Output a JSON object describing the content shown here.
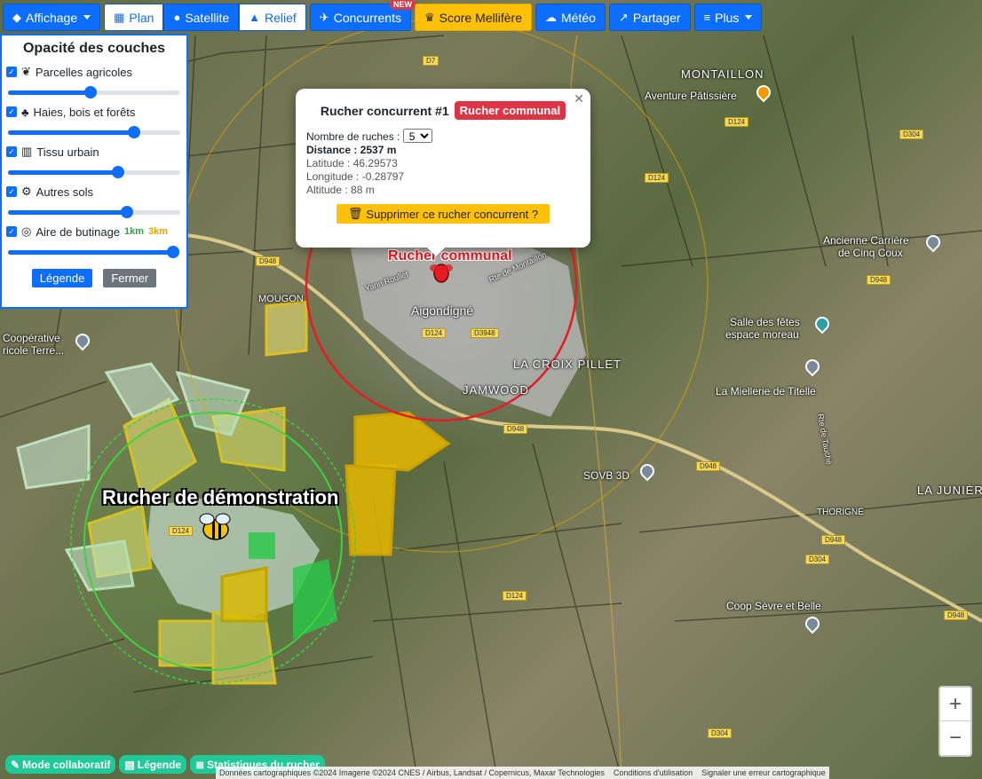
{
  "toolbar": {
    "affichage": "Affichage",
    "plan": "Plan",
    "satellite": "Satellite",
    "relief": "Relief",
    "concurrents": "Concurrents",
    "new_badge": "NEW",
    "score": "Score Mellifère",
    "meteo": "Météo",
    "partager": "Partager",
    "plus": "Plus"
  },
  "panel": {
    "title": "Opacité des couches",
    "layers": [
      {
        "label": "Parcelles agricoles",
        "icon": "leaf-icon",
        "value": 0.48
      },
      {
        "label": "Haies, bois et forêts",
        "icon": "tree-icon",
        "value": 0.73
      },
      {
        "label": "Tissu urbain",
        "icon": "city-icon",
        "value": 0.64
      },
      {
        "label": "Autres sols",
        "icon": "tractor-icon",
        "value": 0.69
      },
      {
        "label": "Aire de butinage",
        "icon": "target-icon",
        "value": 0.96
      }
    ],
    "km1": "1km",
    "km3": "3km",
    "legende": "Légende",
    "fermer": "Fermer"
  },
  "popup": {
    "title": "Rucher concurrent #1",
    "tag": "Rucher communal",
    "nb_ruches_label": "Nombre de ruches :",
    "nb_ruches_value": "5",
    "distance": "Distance : 2537 m",
    "latitude": "Latitude : 46.29573",
    "longitude": "Longitude : -0.28797",
    "altitude": "Altitude : 88 m",
    "delete": "Supprimer ce rucher concurrent ?"
  },
  "map": {
    "hive_demo": "Rucher de démonstration",
    "hive_comm": "Rucher communal",
    "labels": {
      "montaillon": "MONTAILLON",
      "aventure": "Aventure Pâtissière",
      "carriere1": "Ancienne Carrière",
      "carriere2": "de Cinq Coux",
      "salle1": "Salle des fêtes",
      "salle2": "espace moreau",
      "miellerie": "La Miellerie de Titelle",
      "croix": "LA CROIX PILLET",
      "aigondigne": "Aigondigné",
      "jamwood": "JAMWOOD",
      "mougon": "MOUGON",
      "cooperative1": "Coopérative",
      "cooperative2": "ricole Terre...",
      "sovb": "SOVB 3D",
      "thorigne": "THORIGNÉ",
      "juniere": "LA JUNIÈR",
      "coop": "Coop Sèvre et Belle",
      "yann": "Yann Roullet",
      "montalion": "Rte de Montaillon",
      "rte_tauche": "Rte de Tauché"
    },
    "roads": [
      "D7",
      "D124",
      "D304",
      "D124",
      "D948",
      "D948",
      "D124",
      "D948",
      "D948",
      "D304",
      "D948",
      "D124",
      "D304",
      "D124",
      "D948",
      "D3948",
      "D124"
    ]
  },
  "zoom": {
    "in": "+",
    "out": "−"
  },
  "bottom": {
    "collab": "Mode collaboratif",
    "legende": "Légende",
    "stats": "Statistiques du rucher"
  },
  "attribution": {
    "data": "Données cartographiques ©2024 Imagerie ©2024 CNES / Airbus, Landsat / Copernicus, Maxar Technologies",
    "terms": "Conditions d'utilisation",
    "report": "Signaler une erreur cartographique"
  }
}
